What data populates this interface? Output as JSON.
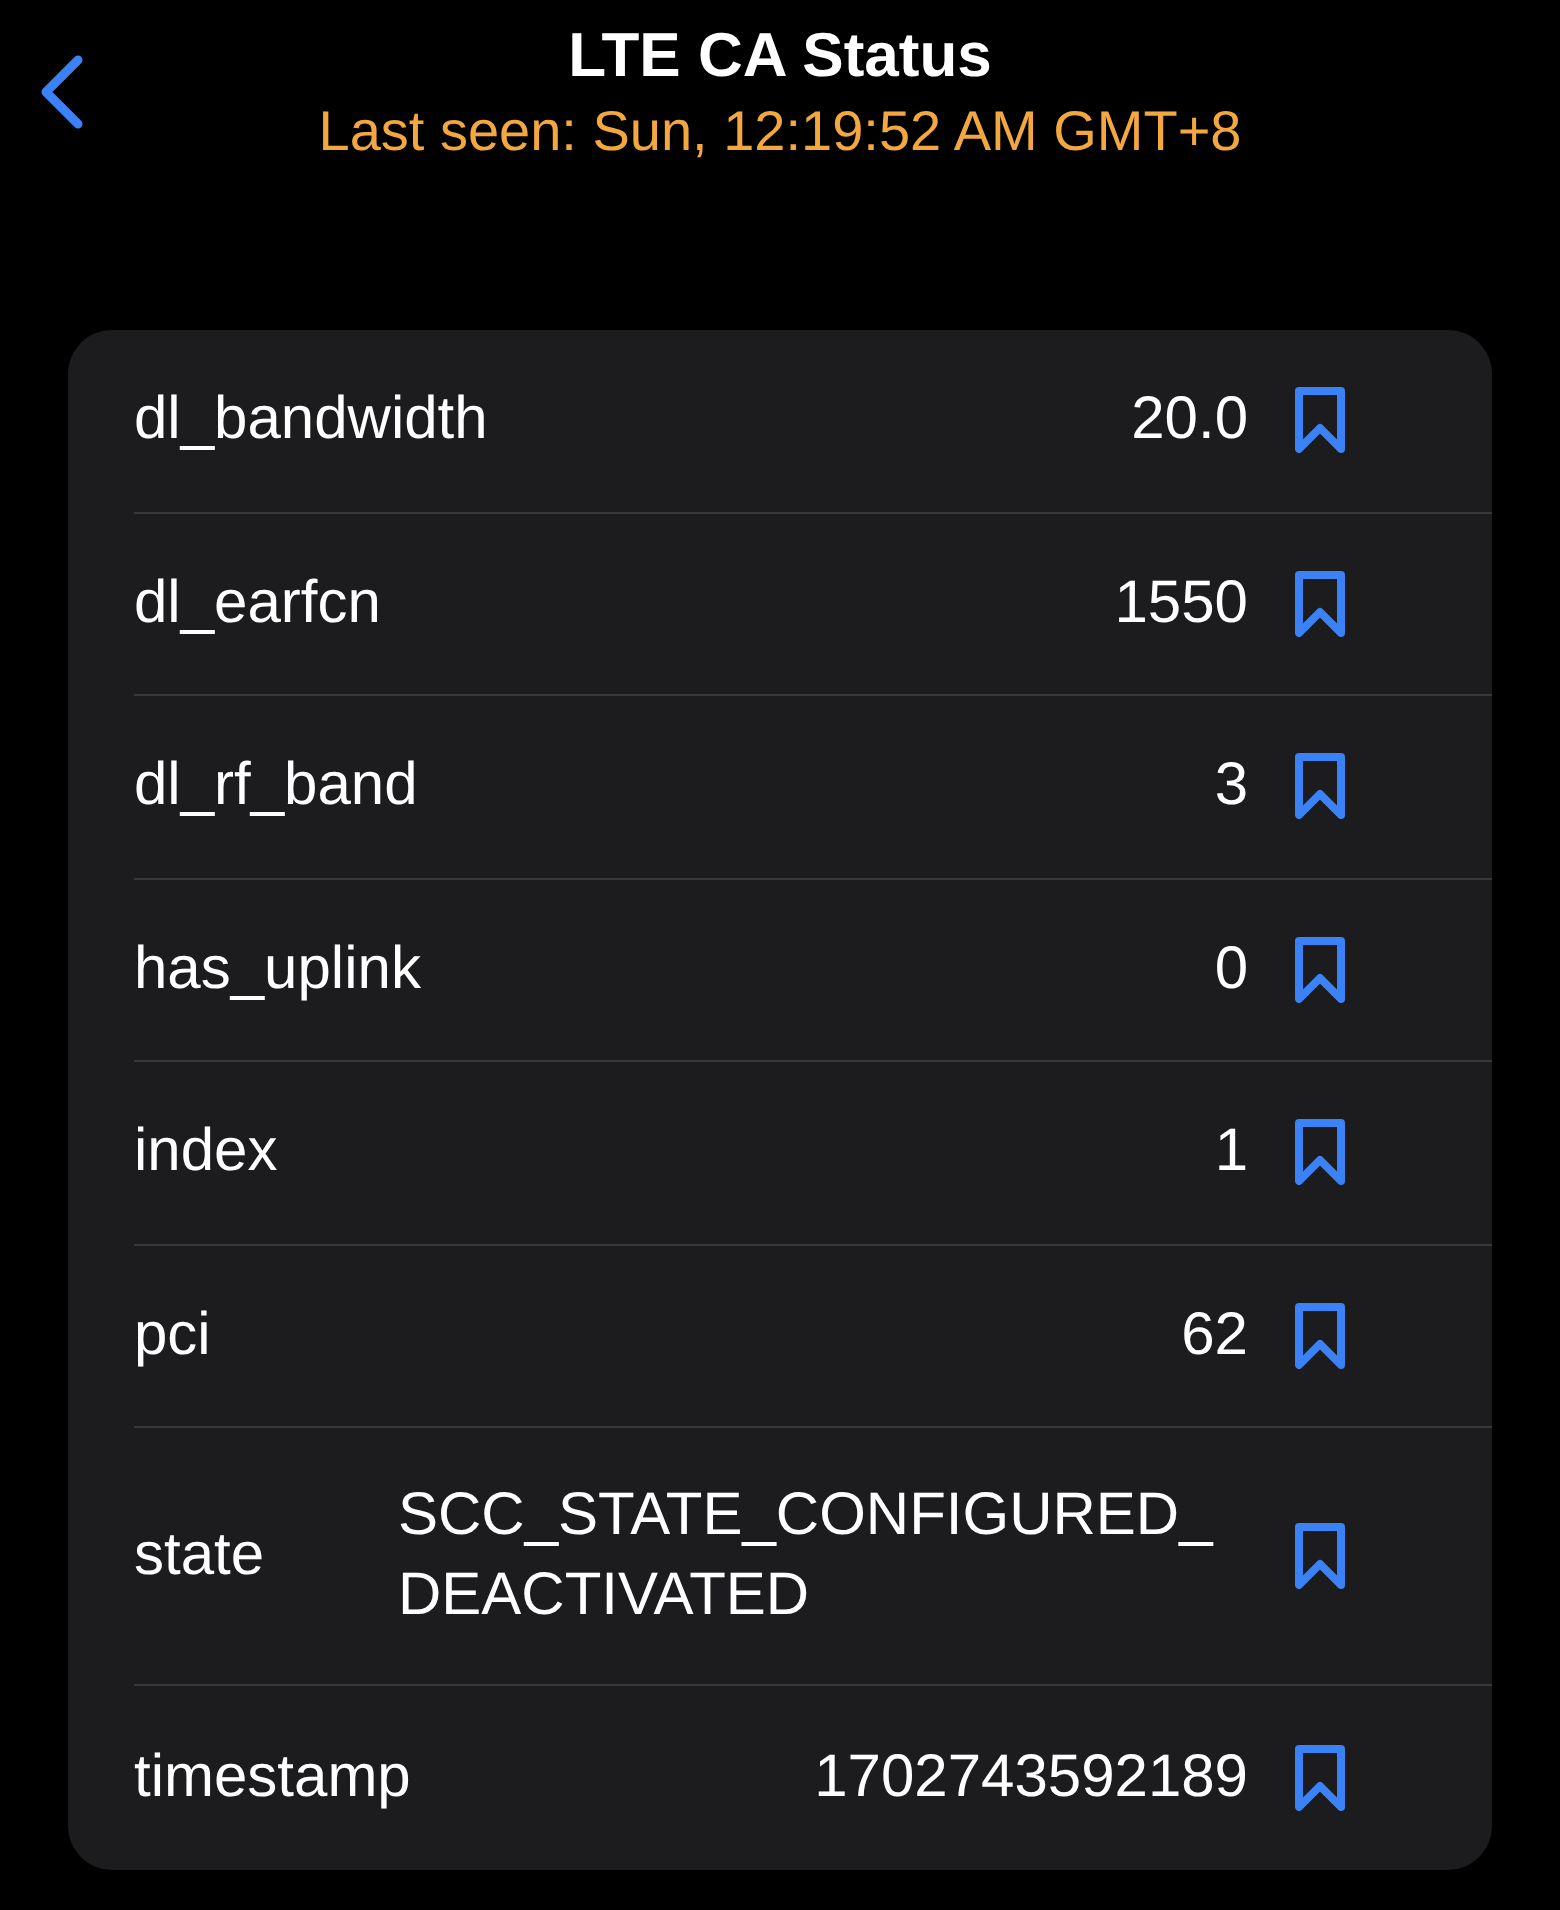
{
  "nav": {
    "title": "LTE CA Status",
    "subtitle": "Last seen: Sun, 12:19:52 AM GMT+8"
  },
  "fields": [
    {
      "name": "dl_bandwidth",
      "value": "20.0",
      "bookmarked": false
    },
    {
      "name": "dl_earfcn",
      "value": "1550",
      "bookmarked": false
    },
    {
      "name": "dl_rf_band",
      "value": "3",
      "bookmarked": false
    },
    {
      "name": "has_uplink",
      "value": "0",
      "bookmarked": false
    },
    {
      "name": "index",
      "value": "1",
      "bookmarked": false
    },
    {
      "name": "pci",
      "value": "62",
      "bookmarked": false
    },
    {
      "name": "state",
      "value": "SCC_STATE_CONFIGURED_DEACTIVATED",
      "bookmarked": false
    },
    {
      "name": "timestamp",
      "value": "1702743592189",
      "bookmarked": false
    }
  ]
}
